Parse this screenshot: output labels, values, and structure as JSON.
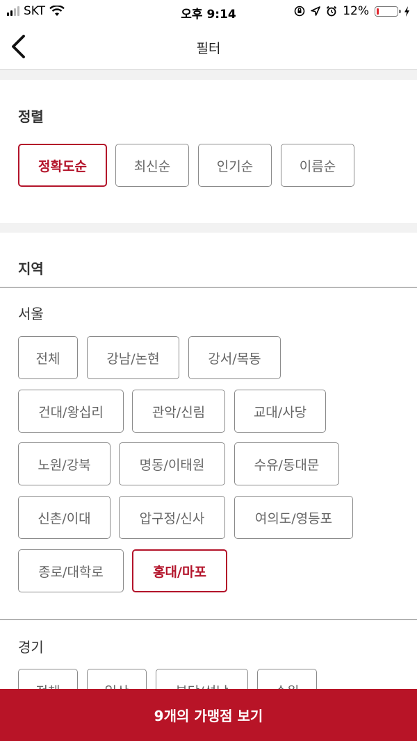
{
  "status_bar": {
    "carrier": "SKT",
    "time": "오후 9:14",
    "battery_percent": "12%",
    "battery_level": 0.12,
    "icons": [
      "signal-icon",
      "wifi-icon",
      "orientation-lock-icon",
      "location-icon",
      "alarm-icon",
      "battery-icon",
      "charging-icon"
    ]
  },
  "header": {
    "back_icon": "chevron-left-icon",
    "title": "필터"
  },
  "sort": {
    "title": "정렬",
    "options": [
      "정확도순",
      "최신순",
      "인기순",
      "이름순"
    ],
    "selected": "정확도순"
  },
  "region": {
    "title": "지역",
    "seoul": {
      "label": "서울",
      "items": [
        "전체",
        "강남/논현",
        "강서/목동",
        "건대/왕십리",
        "관악/신림",
        "교대/사당",
        "노원/강북",
        "명동/이태원",
        "수유/동대문",
        "신촌/이대",
        "압구정/신사",
        "여의도/영등포",
        "종로/대학로",
        "홍대/마포"
      ],
      "selected": "홍대/마포"
    },
    "gyeonggi": {
      "label": "경기",
      "items": [
        "전체",
        "일산",
        "분당/성남",
        "수원"
      ]
    }
  },
  "cta": {
    "label": "9개의 가맹점 보기"
  },
  "colors": {
    "accent": "#b3132a",
    "cta_background": "#b81427",
    "chip_border": "#8a8a8a",
    "section_gap": "#f2f2f2"
  }
}
